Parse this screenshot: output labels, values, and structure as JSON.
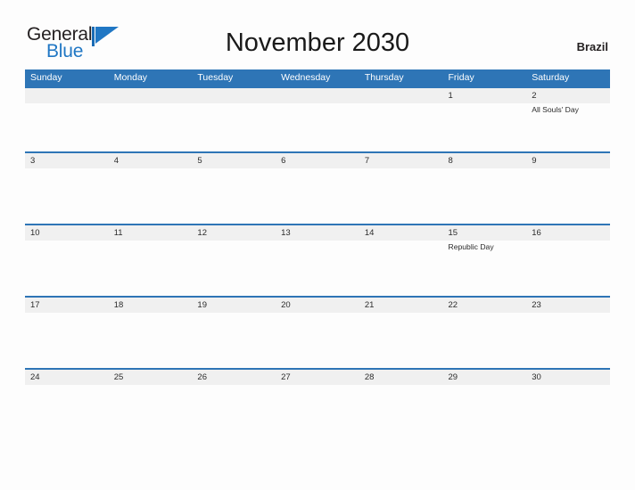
{
  "brand": {
    "name_part1": "General",
    "name_part2": "Blue",
    "flag_icon": "blue-pennant-flag-icon",
    "color_dark": "#231f20",
    "color_blue": "#2077c4"
  },
  "header": {
    "title": "November 2030",
    "country": "Brazil"
  },
  "theme": {
    "header_blue": "#2e75b6",
    "band_gray": "#f0f0f0",
    "text_dark": "#2b2b2b",
    "page_bg": "#fdfdfd"
  },
  "calendar": {
    "month": "November",
    "year": "2030",
    "weekdays": [
      "Sunday",
      "Monday",
      "Tuesday",
      "Wednesday",
      "Thursday",
      "Friday",
      "Saturday"
    ],
    "weeks": [
      [
        {
          "day": ""
        },
        {
          "day": ""
        },
        {
          "day": ""
        },
        {
          "day": ""
        },
        {
          "day": ""
        },
        {
          "day": "1",
          "event": ""
        },
        {
          "day": "2",
          "event": "All Souls' Day"
        }
      ],
      [
        {
          "day": "3",
          "event": ""
        },
        {
          "day": "4",
          "event": ""
        },
        {
          "day": "5",
          "event": ""
        },
        {
          "day": "6",
          "event": ""
        },
        {
          "day": "7",
          "event": ""
        },
        {
          "day": "8",
          "event": ""
        },
        {
          "day": "9",
          "event": ""
        }
      ],
      [
        {
          "day": "10",
          "event": ""
        },
        {
          "day": "11",
          "event": ""
        },
        {
          "day": "12",
          "event": ""
        },
        {
          "day": "13",
          "event": ""
        },
        {
          "day": "14",
          "event": ""
        },
        {
          "day": "15",
          "event": "Republic Day"
        },
        {
          "day": "16",
          "event": ""
        }
      ],
      [
        {
          "day": "17",
          "event": ""
        },
        {
          "day": "18",
          "event": ""
        },
        {
          "day": "19",
          "event": ""
        },
        {
          "day": "20",
          "event": ""
        },
        {
          "day": "21",
          "event": ""
        },
        {
          "day": "22",
          "event": ""
        },
        {
          "day": "23",
          "event": ""
        }
      ],
      [
        {
          "day": "24",
          "event": ""
        },
        {
          "day": "25",
          "event": ""
        },
        {
          "day": "26",
          "event": ""
        },
        {
          "day": "27",
          "event": ""
        },
        {
          "day": "28",
          "event": ""
        },
        {
          "day": "29",
          "event": ""
        },
        {
          "day": "30",
          "event": ""
        }
      ]
    ],
    "holidays": [
      {
        "date": "2",
        "name": "All Souls' Day"
      },
      {
        "date": "15",
        "name": "Republic Day"
      }
    ]
  }
}
